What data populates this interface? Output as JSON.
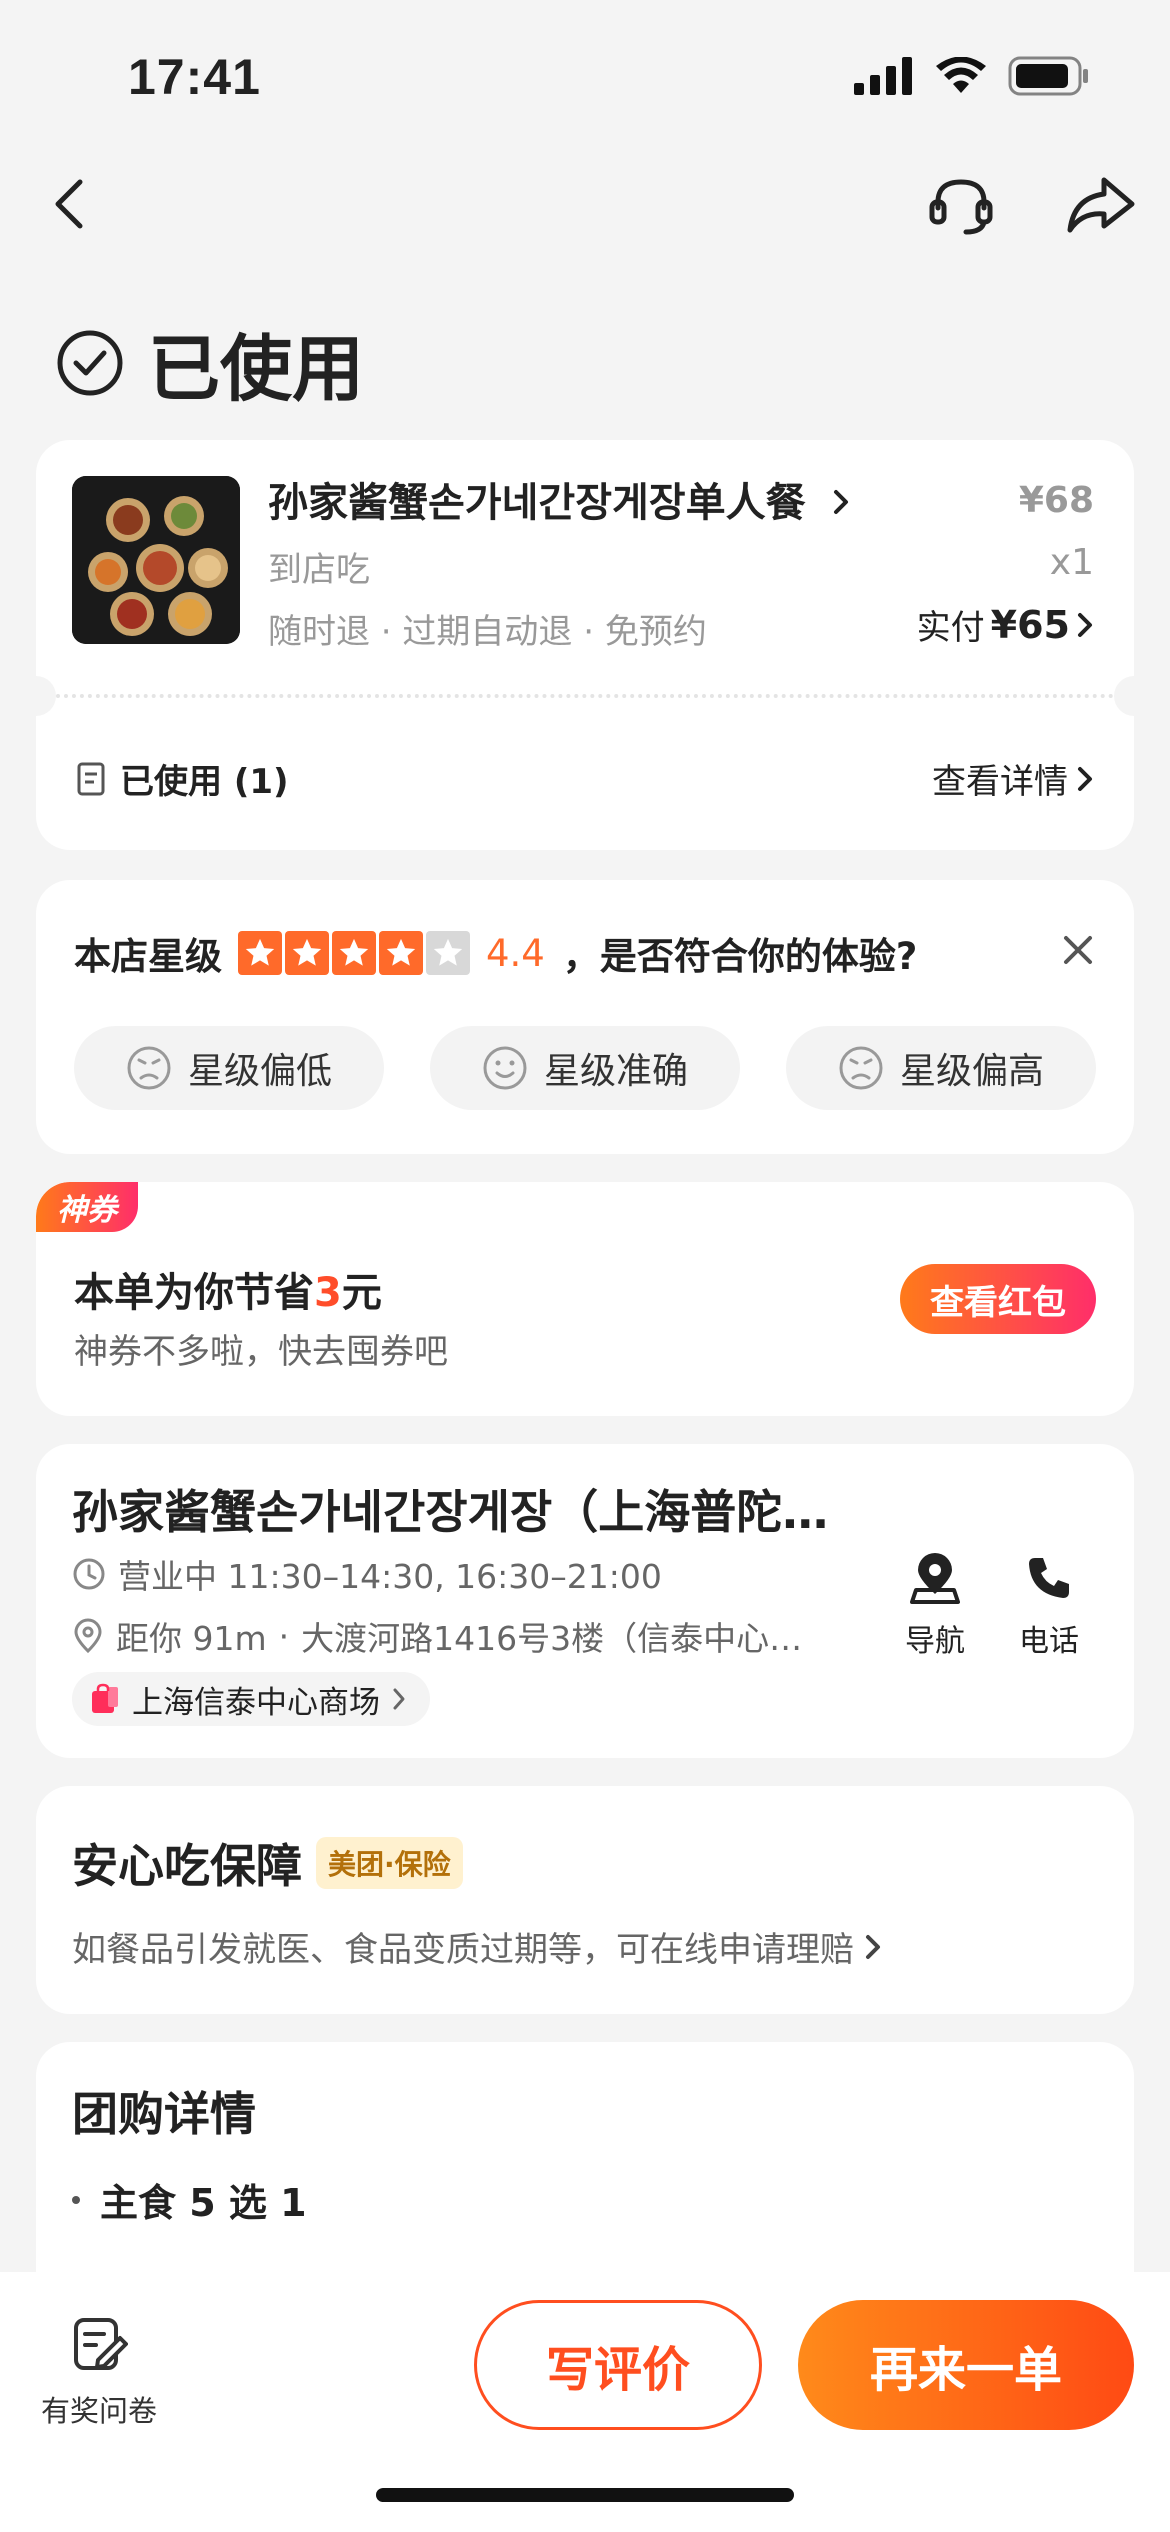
{
  "status_bar": {
    "time": "17:41"
  },
  "page": {
    "status_label": "已使用"
  },
  "order": {
    "product_name": "孙家酱蟹손가네간장게장单人餐",
    "subtitle": "到店吃",
    "tags": "随时退 · 过期自动退 · 免预约",
    "original_price": "¥68",
    "quantity": "x1",
    "paid_label": "实付",
    "paid_amount": "¥65",
    "used_label": "已使用 (1)",
    "detail_link": "查看详情"
  },
  "rating": {
    "prefix": "本店星级",
    "score": "4.4",
    "star_level": 4.4,
    "question": "，是否符合你的体验?",
    "options": [
      "星级偏低",
      "星级准确",
      "星级偏高"
    ]
  },
  "coupon": {
    "badge": "神券",
    "save_prefix": "本单为你节省",
    "save_amount": "3",
    "save_suffix": "元",
    "subtitle": "神券不多啦，快去囤券吧",
    "button": "查看红包"
  },
  "shop": {
    "name": "孙家酱蟹손가네간장게장（上海普陀…",
    "hours": "营业中 11:30–14:30, 16:30–21:00",
    "distance": "距你 91m",
    "address": "大渡河路1416号3楼（信泰中心…",
    "mall": "上海信泰中心商场",
    "nav_label": "导航",
    "phone_label": "电话"
  },
  "guarantee": {
    "title": "安心吃保障",
    "badge": "美团·保险",
    "desc": "如餐品引发就医、食品变质过期等，可在线申请理赔"
  },
  "group_detail": {
    "title": "团购详情",
    "item": "主食 5 选 1"
  },
  "bottom": {
    "survey": "有奖问卷",
    "review": "写评价",
    "again": "再来一单"
  },
  "colors": {
    "accent": "#ff4e1f",
    "star": "#ff6a2a"
  }
}
